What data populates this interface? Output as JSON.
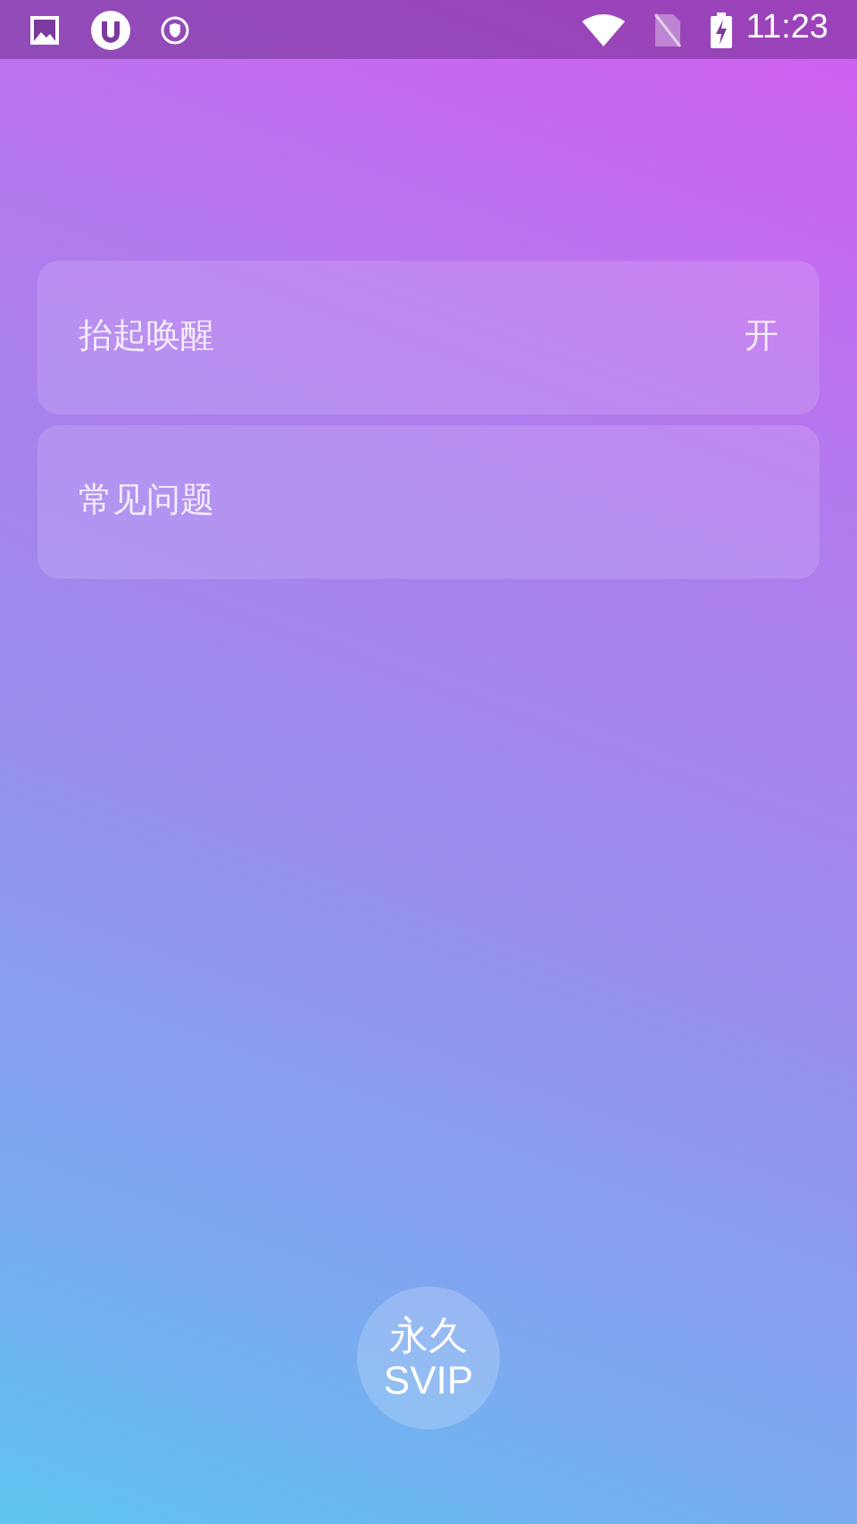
{
  "status_bar": {
    "time": "11:23"
  },
  "settings": [
    {
      "label": "抬起唤醒",
      "value": "开"
    },
    {
      "label": "常见问题"
    }
  ],
  "svip_button": {
    "line_1": "永久",
    "line_2": "SVIP"
  }
}
